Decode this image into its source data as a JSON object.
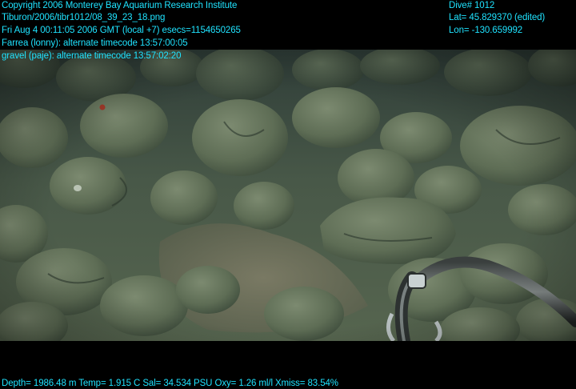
{
  "overlay_top_left": {
    "copyright": "Copyright 2006 Monterey Bay Aquarium Research Institute",
    "file_path": "Tiburon/2006/tibr1012/08_39_23_18.png",
    "datetime": "Fri Aug  4 00:11:05 2006 GMT (local +7)  esecs=1154650265",
    "timecode_1": "Farrea (lonny): alternate timecode 13:57:00:05",
    "timecode_2": "gravel (paje): alternate timecode 13:57:02:20"
  },
  "overlay_top_right": {
    "dive": "Dive# 1012",
    "lat": "Lat= 45.829370 (edited)",
    "lon": "Lon= -130.659992"
  },
  "overlay_bottom": {
    "sensors": "Depth= 1986.48 m  Temp= 1.915 C  Sal= 34.534 PSU  Oxy= 1.26 ml/l  Xmiss= 83.54%"
  },
  "colors": {
    "overlay_text": "#1fe3ff",
    "sediment": "#4e5d4f",
    "rock": "#56664f",
    "background": "#000000"
  }
}
